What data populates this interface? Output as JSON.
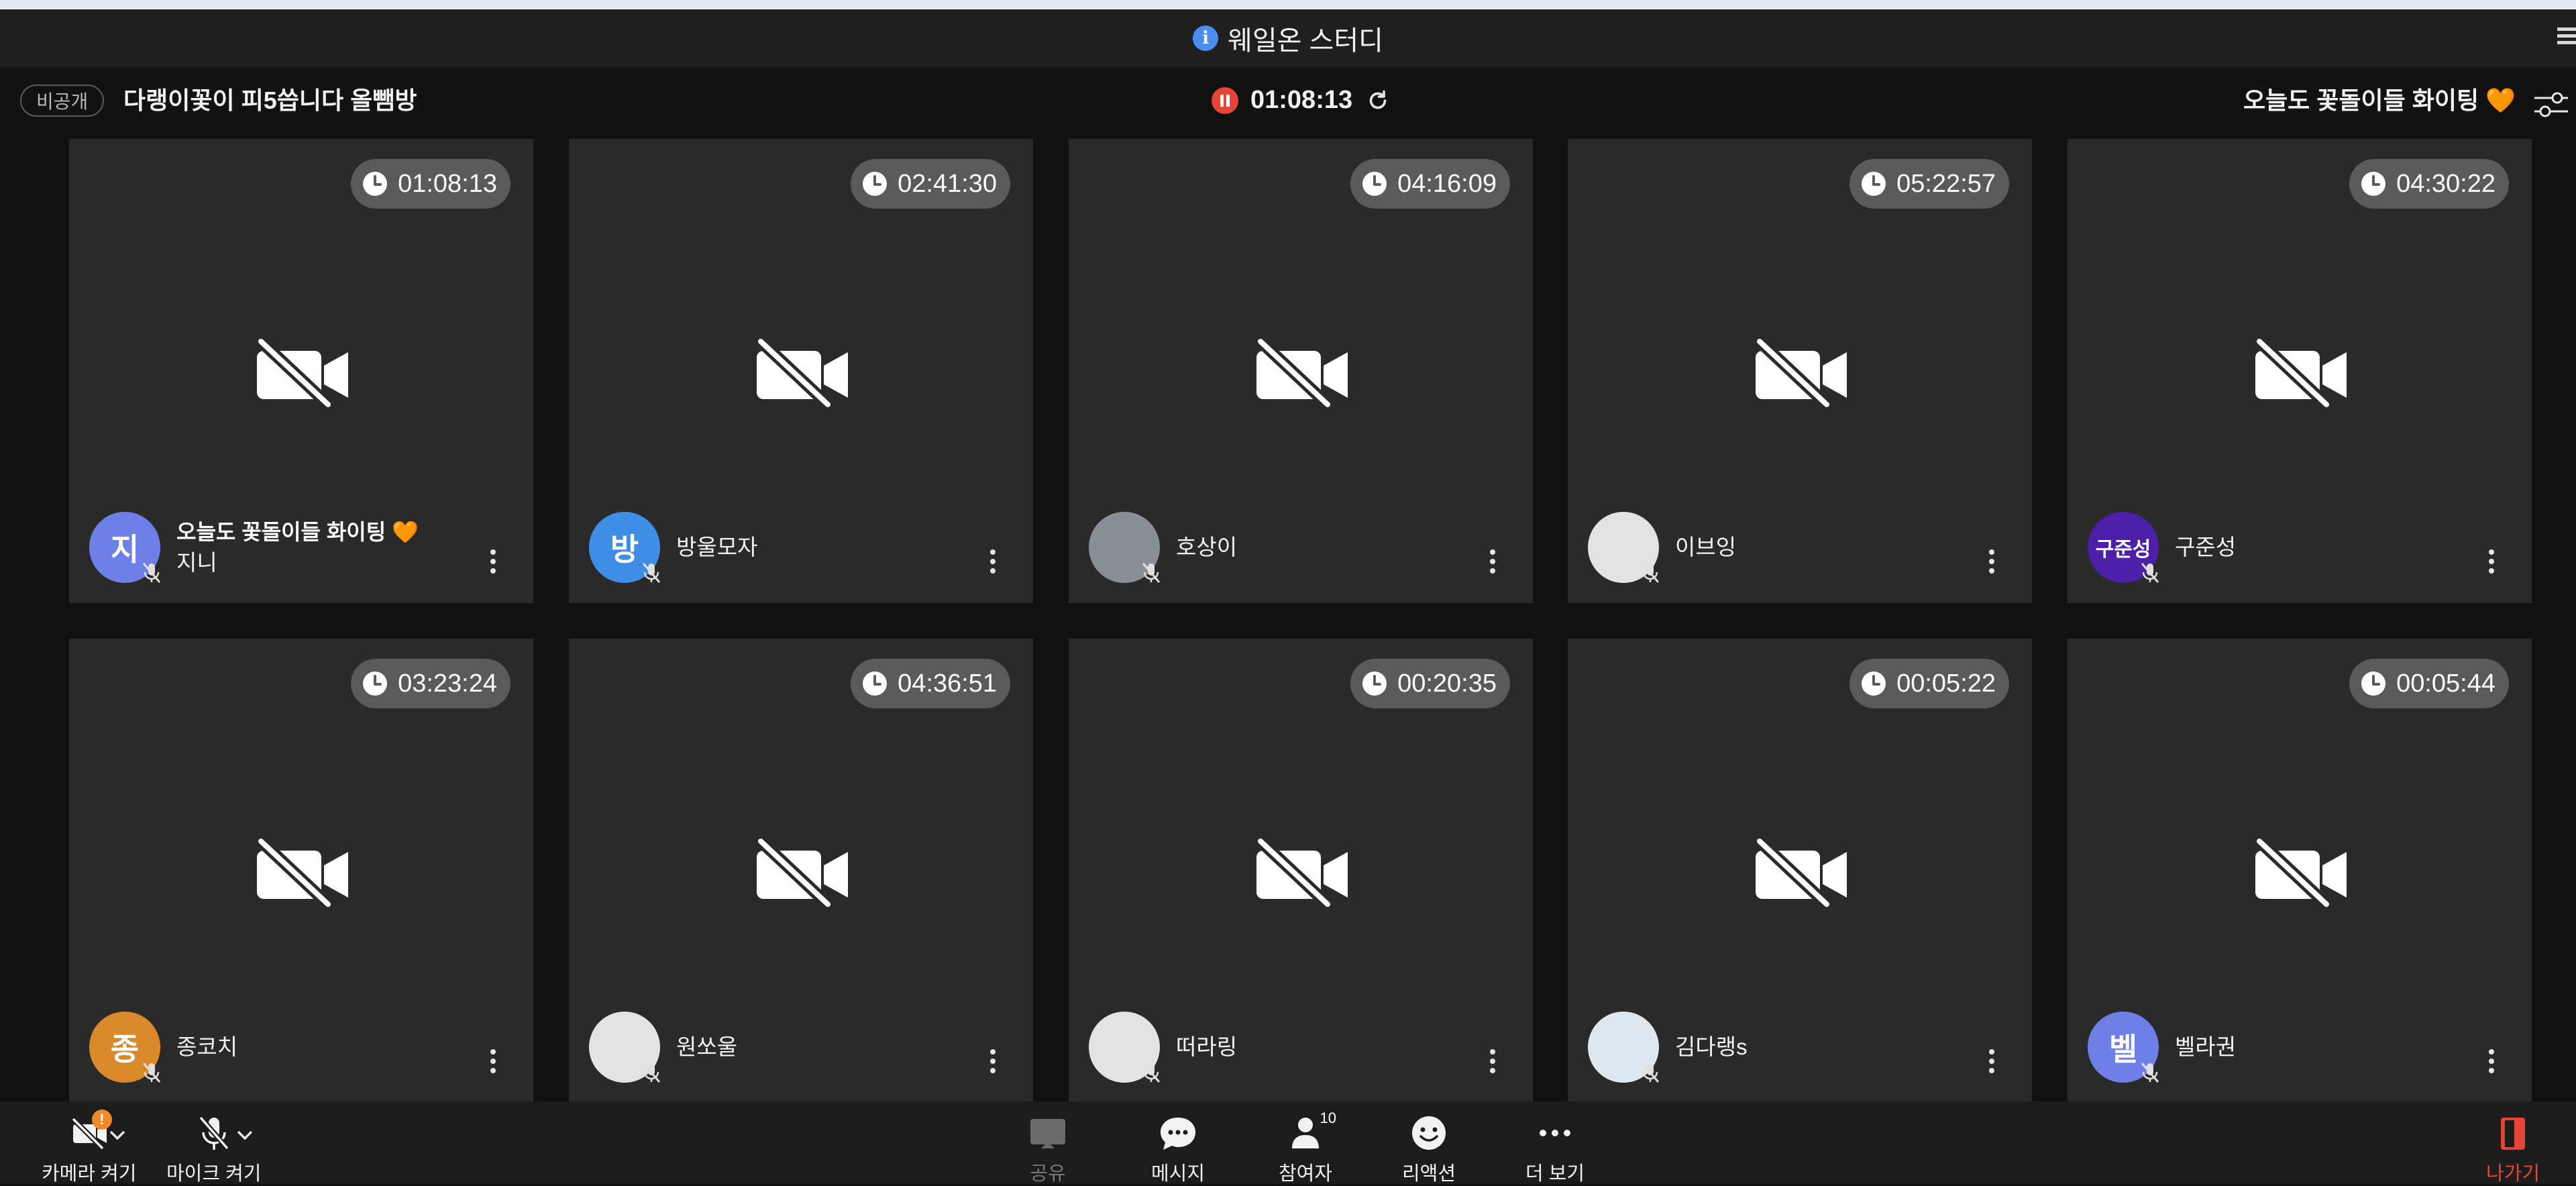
{
  "window": {
    "title": "웨일온 스터디"
  },
  "room": {
    "visibility": "비공개",
    "name": "다랭이꽃이 피5씁니다 올뺌방",
    "timer": "01:08:13",
    "status_message": "오늘도 꽃돌이들 화이팅",
    "status_emoji": "🧡"
  },
  "participants": [
    {
      "name": "지니",
      "status": "오늘도 꽃돌이들 화이팅",
      "status_emoji": "🧡",
      "time": "01:08:13",
      "avatar_text": "지",
      "avatar_color": "#6f7fe8"
    },
    {
      "name": "방울모자",
      "time": "02:41:30",
      "avatar_text": "방",
      "avatar_color": "#3f8ee6"
    },
    {
      "name": "호상이",
      "time": "04:16:09",
      "avatar_text": "",
      "avatar_color": "#8a8f96"
    },
    {
      "name": "이브잉",
      "time": "05:22:57",
      "avatar_text": "",
      "avatar_color": "#e3e3e3"
    },
    {
      "name": "구준성",
      "time": "04:30:22",
      "avatar_text": "구준성",
      "avatar_color": "#4b1fa8"
    },
    {
      "name": "종코치",
      "time": "03:23:24",
      "avatar_text": "종",
      "avatar_color": "#d9892a"
    },
    {
      "name": "원쏘울",
      "time": "04:36:51",
      "avatar_text": "",
      "avatar_color": "#e3e3e3"
    },
    {
      "name": "떠라링",
      "time": "00:20:35",
      "avatar_text": "",
      "avatar_color": "#e3e3e3"
    },
    {
      "name": "김다랭s",
      "time": "00:05:22",
      "avatar_text": "",
      "avatar_color": "#dfe8ee"
    },
    {
      "name": "벨라권",
      "time": "00:05:44",
      "avatar_text": "벨",
      "avatar_color": "#6f7fe8"
    }
  ],
  "controls": {
    "camera": "카메라 켜기",
    "camera_warning": "!",
    "mic": "마이크 켜기",
    "share": "공유",
    "message": "메시지",
    "participants": "참여자",
    "participants_count": "10",
    "reaction": "리액션",
    "more": "더 보기",
    "leave": "나가기"
  },
  "colors": {
    "accent_red": "#e64436",
    "heart": "#f47a36",
    "tile_bg": "#2a2a2a"
  }
}
